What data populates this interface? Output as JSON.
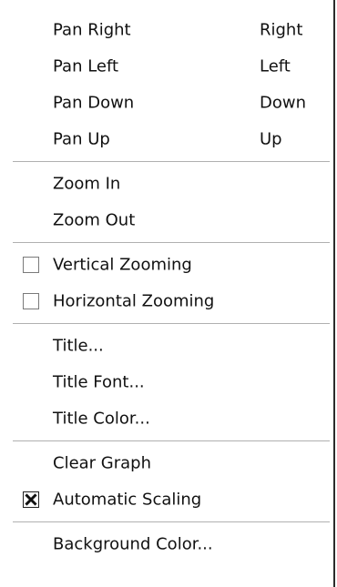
{
  "menu": {
    "items": [
      {
        "label": "Pan Right",
        "shortcut": "Right"
      },
      {
        "label": "Pan Left",
        "shortcut": "Left"
      },
      {
        "label": "Pan Down",
        "shortcut": "Down"
      },
      {
        "label": "Pan Up",
        "shortcut": "Up"
      },
      {
        "label": "Zoom In"
      },
      {
        "label": "Zoom Out"
      },
      {
        "label": "Vertical Zooming",
        "checked": false
      },
      {
        "label": "Horizontal Zooming",
        "checked": false
      },
      {
        "label": "Title..."
      },
      {
        "label": "Title Font..."
      },
      {
        "label": "Title Color..."
      },
      {
        "label": "Clear Graph"
      },
      {
        "label": "Automatic Scaling",
        "checked": true
      },
      {
        "label": "Background Color..."
      }
    ]
  }
}
